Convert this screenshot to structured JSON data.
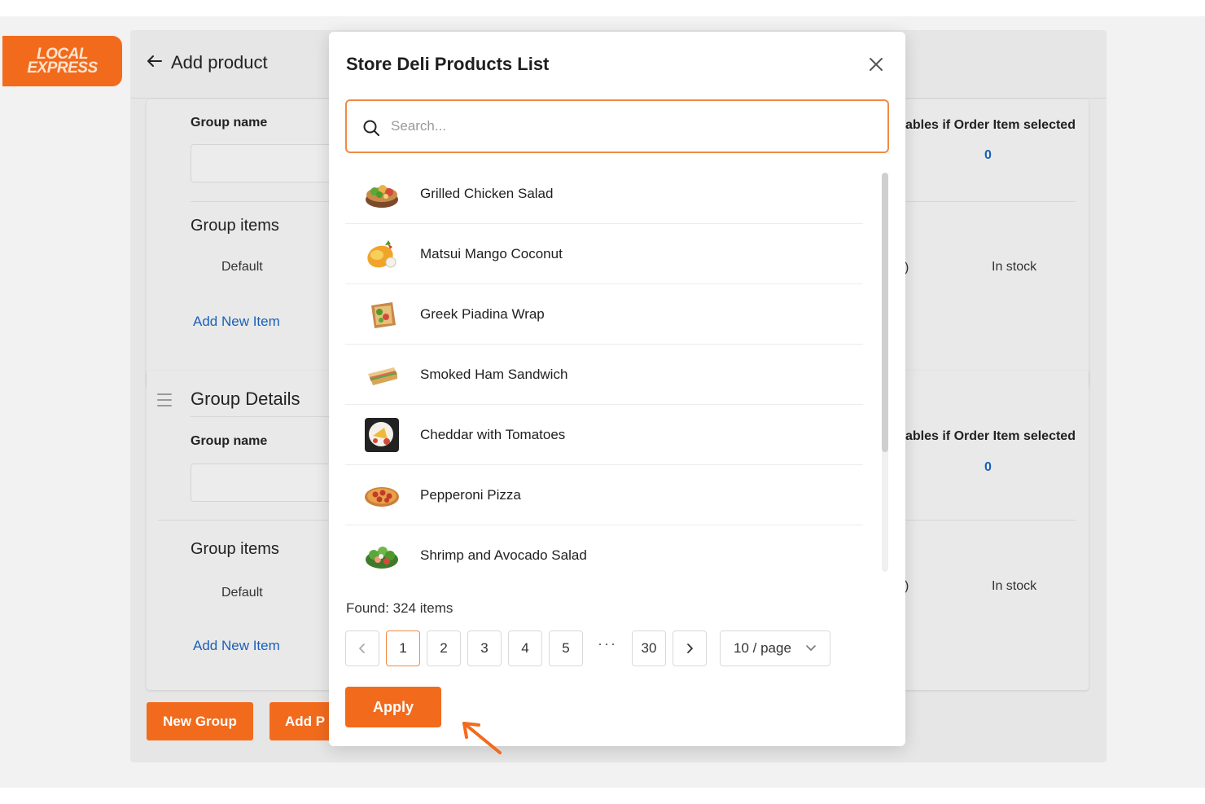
{
  "logo": {
    "line1": "LOCAL",
    "line2": "EXPRESS"
  },
  "header": {
    "title": "Add product"
  },
  "group1": {
    "group_name_label": "Group name",
    "group_items_label": "Group items",
    "default_label": "Default",
    "add_item_link": "Add New Item",
    "right_header": "ables if Order Item selected",
    "right_value": "0",
    "stock": "In stock",
    "cut_char": ")"
  },
  "group2": {
    "title": "Group Details",
    "group_name_label": "Group name",
    "group_items_label": "Group items",
    "default_label": "Default",
    "add_item_link": "Add New Item",
    "right_header": "ables if Order Item selected",
    "right_value": "0",
    "stock": "In stock",
    "cut_char": ")"
  },
  "footer_buttons": {
    "new_group": "New Group",
    "add_partial": "Add P"
  },
  "modal": {
    "title": "Store Deli Products List",
    "search_placeholder": "Search...",
    "items": [
      {
        "label": "Grilled Chicken Salad",
        "icon": "salad-bowl-icon"
      },
      {
        "label": "Matsui Mango Coconut",
        "icon": "mango-icon"
      },
      {
        "label": "Greek Piadina Wrap",
        "icon": "wrap-icon"
      },
      {
        "label": "Smoked Ham Sandwich",
        "icon": "sandwich-icon"
      },
      {
        "label": "Cheddar with Tomatoes",
        "icon": "cheese-plate-icon"
      },
      {
        "label": "Pepperoni Pizza",
        "icon": "pizza-icon"
      },
      {
        "label": "Shrimp and Avocado Salad",
        "icon": "salad-icon"
      }
    ],
    "found": "Found: 324 items",
    "pages": [
      "1",
      "2",
      "3",
      "4",
      "5",
      "30"
    ],
    "ellipsis": "···",
    "current_page": "1",
    "page_size": "10 / page",
    "apply": "Apply"
  },
  "colors": {
    "accent": "#f26b1d",
    "link": "#1b5fb8",
    "search_border": "#f08a45"
  }
}
